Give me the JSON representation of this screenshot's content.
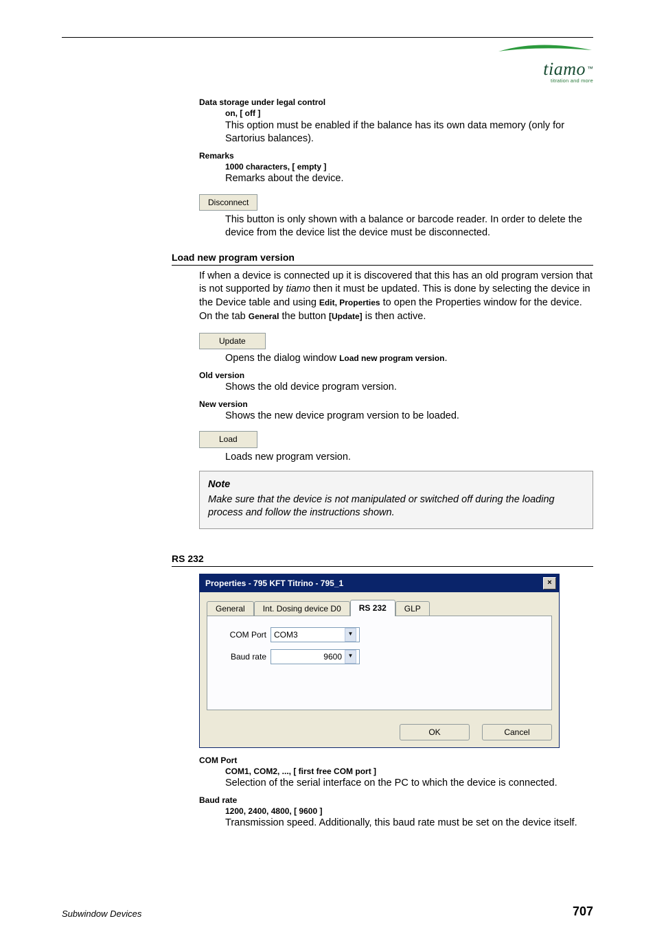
{
  "logo": {
    "name": "tiamo",
    "tm": "™",
    "tagline": "titration and more"
  },
  "top": {
    "data_storage": {
      "name": "Data storage under legal control",
      "range": "on, [ off ]",
      "desc": "This option must be enabled if the balance has its own data memory (only for Sartorius balances)."
    },
    "remarks": {
      "name": "Remarks",
      "range": "1000 characters, [ empty ]",
      "desc": "Remarks about the device."
    },
    "disconnect": {
      "btn": "Disconnect",
      "desc": "This button is only shown with a balance or barcode reader. In order to delete the device from the device list the device must be disconnected."
    }
  },
  "load_section": {
    "heading": "Load new program version",
    "intro_a": "If when a device is connected up it is discovered that this has an old program version that is not supported by ",
    "intro_sw": "tiamo",
    "intro_b": " then it must be updated. This is done by selecting the device in the Device table and using ",
    "intro_bold1": "Edit, Properties",
    "intro_c": " to open the Properties window for the device. On the tab ",
    "intro_bold2": "General",
    "intro_d": " the button ",
    "intro_bold3": "[Update]",
    "intro_e": " is then active.",
    "update_btn": "Update",
    "update_desc_a": "Opens the dialog window ",
    "update_desc_b": "Load new program version",
    "update_desc_c": ".",
    "old": {
      "name": "Old version",
      "desc": "Shows the old device program version."
    },
    "new": {
      "name": "New version",
      "desc": "Shows the new device program version to be loaded."
    },
    "load_btn": "Load",
    "load_desc": "Loads new program version.",
    "note_title": "Note",
    "note_text": "Make sure that the device is not manipulated or switched off during the loading process and follow the instructions shown."
  },
  "rs232_section": {
    "heading": "RS 232",
    "dialog": {
      "title": "Properties - 795 KFT Titrino - 795_1",
      "tabs": [
        "General",
        "Int. Dosing device D0",
        "RS 232",
        "GLP"
      ],
      "active_tab": "RS 232",
      "com_label": "COM Port",
      "com_value": "COM3",
      "baud_label": "Baud rate",
      "baud_value": "9600",
      "ok": "OK",
      "cancel": "Cancel"
    },
    "com_port": {
      "name": "COM Port",
      "range": "COM1, COM2, ..., [ first free COM port ]",
      "desc": "Selection of the serial interface on the PC to which the device is connected."
    },
    "baud": {
      "name": "Baud rate",
      "range": "1200, 2400, 4800, [ 9600 ]",
      "desc": "Transmission speed. Additionally, this baud rate must be set on the device itself."
    }
  },
  "footer": {
    "left": "Subwindow Devices",
    "right": "707"
  }
}
